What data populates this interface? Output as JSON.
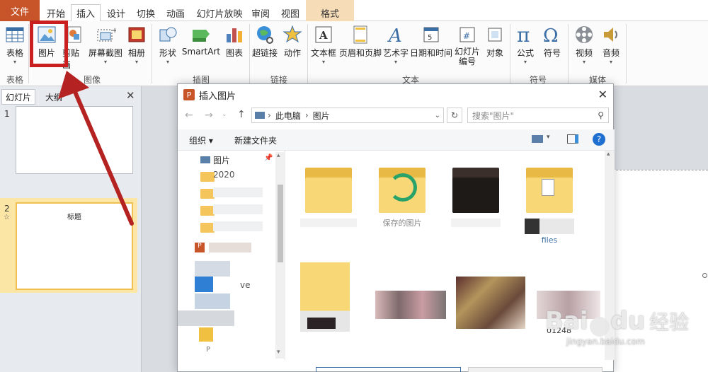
{
  "tabs": {
    "file": "文件",
    "items": [
      "开始",
      "插入",
      "设计",
      "切换",
      "动画",
      "幻灯片放映",
      "审阅",
      "视图",
      "格式"
    ],
    "active": "插入"
  },
  "ribbon": {
    "table": "表格",
    "picture": "图片",
    "clipart": "剪贴画",
    "screenshot": "屏幕截图",
    "album": "相册",
    "shapes": "形状",
    "smartart": "SmartArt",
    "chart": "图表",
    "hyperlink": "超链接",
    "action": "动作",
    "textbox": "文本框",
    "header_footer": "页眉和页脚",
    "wordart": "艺术字",
    "datetime": "日期和时间",
    "slide_number_1": "幻灯片",
    "slide_number_2": "编号",
    "object": "对象",
    "equation": "公式",
    "symbol": "符号",
    "video": "视频",
    "audio": "音频",
    "groups": {
      "tables": "表格",
      "images": "图像",
      "illustrations": "插图",
      "links": "链接",
      "text": "文本",
      "symbols": "符号",
      "media": "媒体"
    }
  },
  "leftpanel": {
    "tab_slides": "幻灯片",
    "tab_outline": "大纲",
    "slides": [
      {
        "number": "1",
        "title": ""
      },
      {
        "number": "2",
        "title": "标题"
      }
    ]
  },
  "dialog": {
    "title": "插入图片",
    "breadcrumb_pc": "此电脑",
    "breadcrumb_folder": "图片",
    "search_placeholder": "搜索\"图片\"",
    "organize": "组织",
    "new_folder": "新建文件夹",
    "nav": {
      "pictures": "图片",
      "item_2020": "2020",
      "item_ve": "ve",
      "item_p": "P"
    },
    "files": {
      "folder2": "保存的图片",
      "folder4_partial": "files",
      "thumb_number": "01248"
    }
  },
  "watermark": {
    "brand": "Bai",
    "brand2": "du",
    "brand_cn": "经验",
    "url": "jingyan.baidu.com"
  },
  "colors": {
    "file_tab": "#c8542a",
    "highlight_red": "#c91f1f",
    "folder_yellow": "#f8d776",
    "context_tab": "#f7dcb8"
  }
}
